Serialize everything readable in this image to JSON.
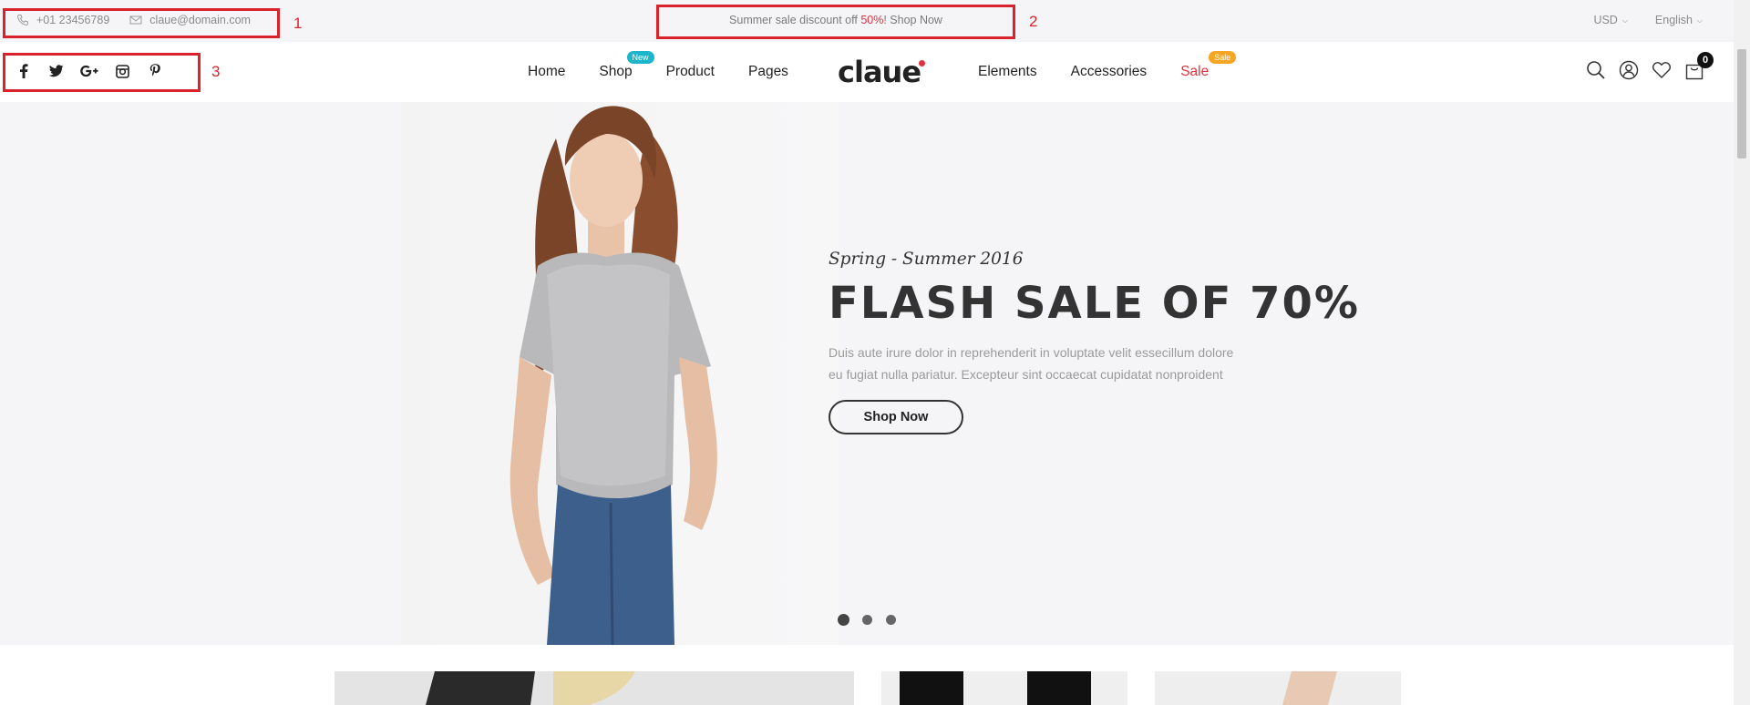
{
  "topbar": {
    "phone": "+01 23456789",
    "email": "claue@domain.com",
    "promo_prefix": "Summer sale discount off ",
    "promo_highlight": "50%",
    "promo_suffix": "! Shop Now",
    "currency": "USD",
    "language": "English"
  },
  "annotations": [
    "1",
    "2",
    "3"
  ],
  "social": [
    "facebook-icon",
    "twitter-icon",
    "google-plus-icon",
    "instagram-icon",
    "pinterest-icon"
  ],
  "nav": {
    "left": [
      {
        "label": "Home"
      },
      {
        "label": "Shop",
        "badge": "New"
      },
      {
        "label": "Product"
      },
      {
        "label": "Pages"
      }
    ],
    "logo": "claue",
    "right": [
      {
        "label": "Elements"
      },
      {
        "label": "Accessories"
      },
      {
        "label": "Sale",
        "badge": "Sale"
      }
    ],
    "cart_count": "0"
  },
  "hero": {
    "subtitle": "Spring - Summer 2016",
    "title": "FLASH SALE OF 70%",
    "desc_line1": "Duis aute irure dolor in reprehenderit in voluptate velit essecillum dolore",
    "desc_line2": "eu fugiat nulla pariatur. Excepteur sint occaecat cupidatat nonproident",
    "button": "Shop Now",
    "slides": 3
  },
  "colors": {
    "accent": "#e2313e",
    "new_badge": "#1cb5cc",
    "sale_badge": "#f6a623",
    "annotation": "#d8222c"
  }
}
